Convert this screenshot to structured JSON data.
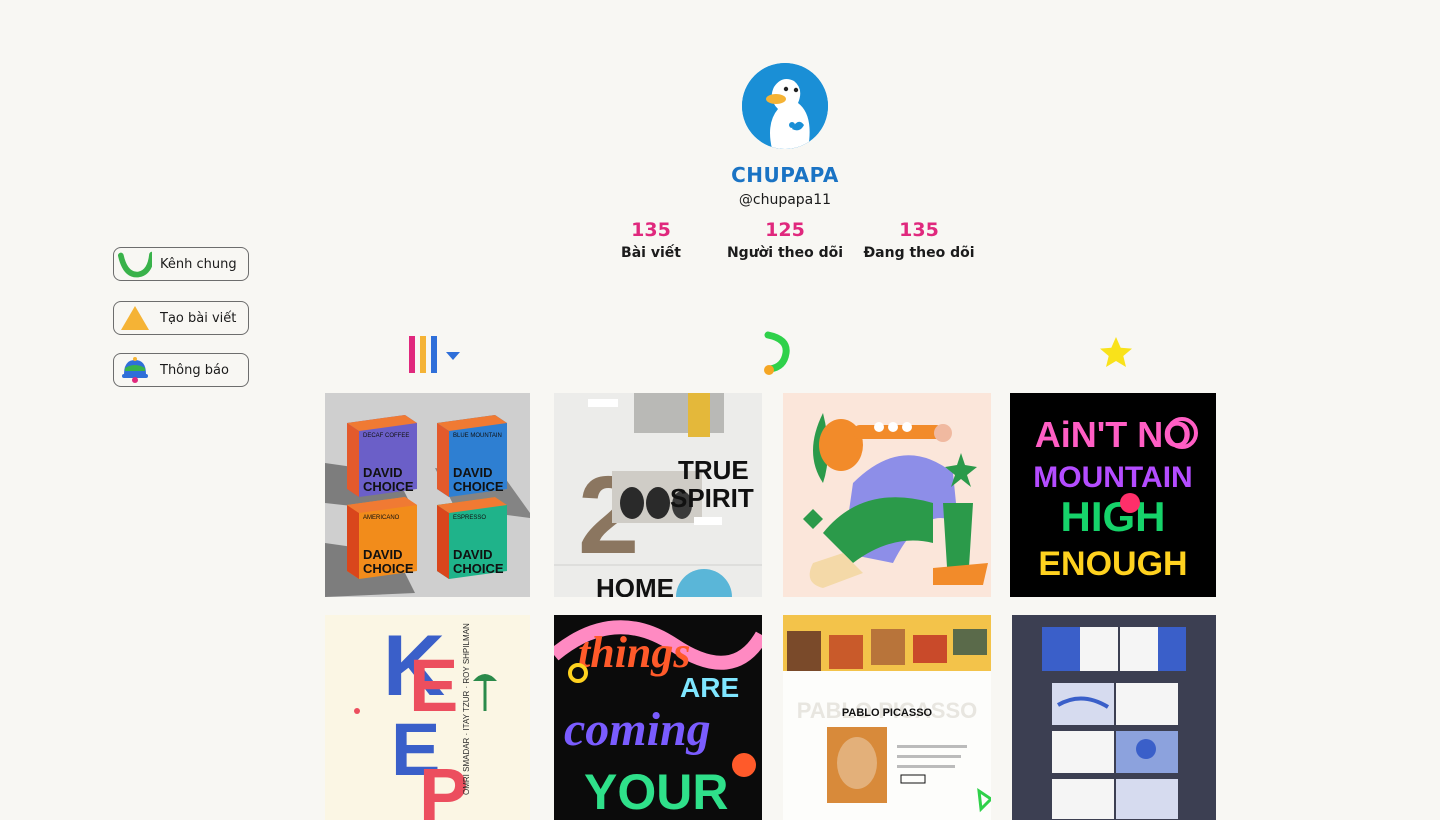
{
  "sidebar": {
    "items": [
      {
        "label": "Kênh chung",
        "icon": "channel-arc-icon"
      },
      {
        "label": "Tạo bài viết",
        "icon": "create-triangle-icon"
      },
      {
        "label": "Thông báo",
        "icon": "bell-icon"
      }
    ]
  },
  "profile": {
    "display_name": "CHUPAPA",
    "handle": "@chupapa11",
    "avatar_icon": "duck-avatar",
    "stats": [
      {
        "value": "135",
        "label": "Bài viết"
      },
      {
        "value": "125",
        "label": "Người theo dõi"
      },
      {
        "value": "135",
        "label": "Đang theo dõi"
      }
    ]
  },
  "tabs": [
    {
      "icon": "grid-bars-icon"
    },
    {
      "icon": "activity-arc-icon"
    },
    {
      "icon": "star-icon"
    }
  ],
  "colors": {
    "accent_blue": "#1a73c4",
    "accent_pink": "#e0287d",
    "background": "#f8f7f3"
  },
  "posts": {
    "coffee": {
      "lines": [
        "DECAF COFFEE",
        "BLUE MOUNTAIN",
        "AMERICANO",
        "ESPRESSO"
      ],
      "brand_a": "DAVID",
      "brand_b": "CHOICE"
    },
    "spirit": {
      "title_a": "TRUE",
      "title_b": "SPIRIT",
      "numeral": "2",
      "footer": "HOME"
    },
    "mountain": {
      "line1": "AiN'T NO",
      "line2": "MOUNTAIN",
      "line3": "HIGH",
      "line4": "ENOUGH"
    },
    "keep": {
      "letters": [
        "K",
        "E",
        "E",
        "P"
      ],
      "side_text": "OMRI SMADAR · ITAY TZUR · ROY SHPILMAN"
    },
    "things": {
      "line1": "things",
      "line2": "ARE",
      "line3": "coming",
      "line4": "YOUR"
    },
    "picasso": {
      "faded": "PABLO PICASSO",
      "title": "PABLO PICASSO"
    }
  }
}
